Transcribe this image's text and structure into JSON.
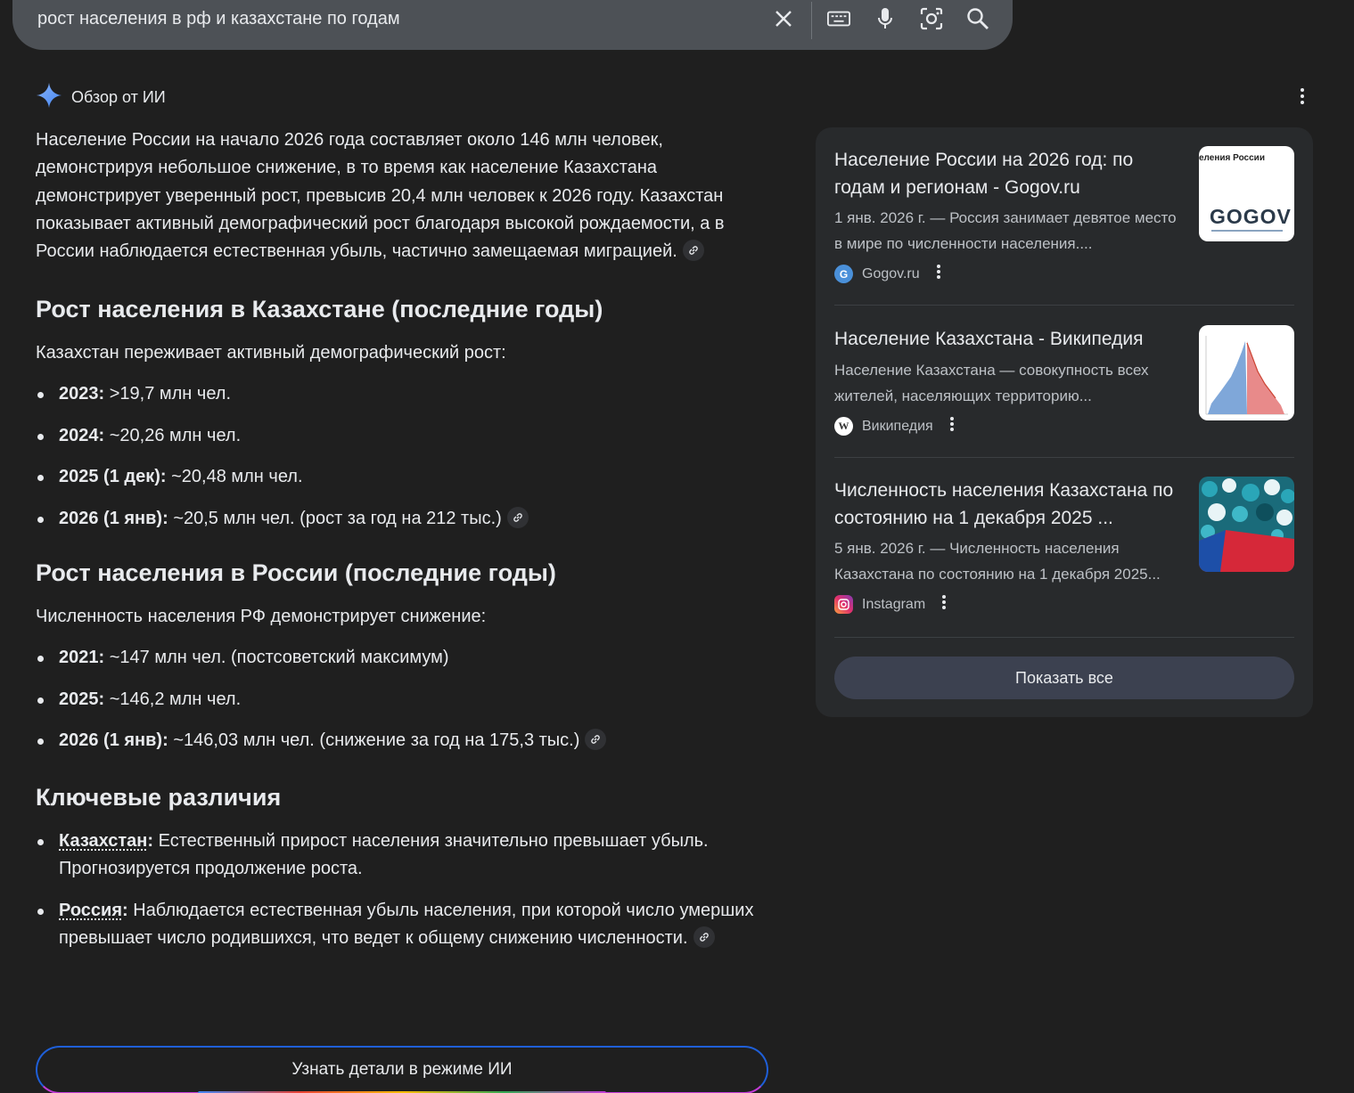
{
  "search": {
    "query": "рост населения в рф и казахстане по годам"
  },
  "overview": {
    "title": "Обзор от ИИ",
    "intro": "Население России на начало 2026 года составляет около 146 млн человек, демонстрируя небольшое снижение, в то время как население Казахстана демонстрирует уверенный рост, превысив 20,4 млн человек к 2026 году. Казахстан показывает активный демографический рост благодаря высокой рождаемости, а в России наблюдается естественная убыль, частично замещаемая миграцией.",
    "kz_section": {
      "heading": "Рост населения в Казахстане (последние годы)",
      "lead": "Казахстан переживает активный демографический рост:",
      "items": [
        {
          "label": "2023:",
          "text": " >19,7 млн чел."
        },
        {
          "label": "2024:",
          "text": " ~20,26 млн чел."
        },
        {
          "label": "2025 (1 дек):",
          "text": " ~20,48 млн чел."
        },
        {
          "label": "2026 (1 янв):",
          "text": " ~20,5 млн чел. (рост за год на 212 тыс.)"
        }
      ]
    },
    "ru_section": {
      "heading": "Рост населения в России (последние годы)",
      "lead": "Численность населения РФ демонстрирует снижение:",
      "items": [
        {
          "label": "2021:",
          "text": " ~147 млн чел. (постсоветский максимум)"
        },
        {
          "label": "2025:",
          "text": " ~146,2 млн чел."
        },
        {
          "label": "2026 (1 янв):",
          "text": " ~146,03 млн чел. (снижение за год на 175,3 тыс.)"
        }
      ]
    },
    "diff_section": {
      "heading": "Ключевые различия",
      "items": [
        {
          "label": "Казахстан",
          "colon": ":",
          "text": " Естественный прирост населения значительно превышает убыль. Прогнозируется продолжение роста."
        },
        {
          "label": "Россия",
          "colon": ":",
          "text": " Наблюдается естественная убыль населения, при которой число умерших превышает число родившихся, что ведет к общему снижению численности."
        }
      ]
    },
    "ai_mode_button": "Узнать детали в режиме ИИ"
  },
  "sources": [
    {
      "title": "Население России на 2026 год: по годам и регионам - Gogov.ru",
      "snippet": "1 янв. 2026 г. — Россия занимает девятое место в мире по численности населения....",
      "site": "Gogov.ru",
      "thumb_caption": "еления России",
      "thumb_logo": "GOGOV"
    },
    {
      "title": "Население Казахстана - Википедия",
      "snippet": "Население Казахстана — совокупность всех жителей, населяющих территорию...",
      "site": "Википедия"
    },
    {
      "title": "Численность населения Казахстана по состоянию на 1 декабря 2025 ...",
      "snippet": "5 янв. 2026 г. — Численность населения Казахстана по состоянию на 1 декабря 2025...",
      "site": "Instagram"
    }
  ],
  "show_all": "Показать все",
  "colors": {
    "background": "#1f1f1f",
    "searchbar": "#4d5156",
    "panel": "#282a2c",
    "text": "#e8eaed",
    "muted": "#bdc1c6",
    "accent": "#8ab4f8"
  }
}
